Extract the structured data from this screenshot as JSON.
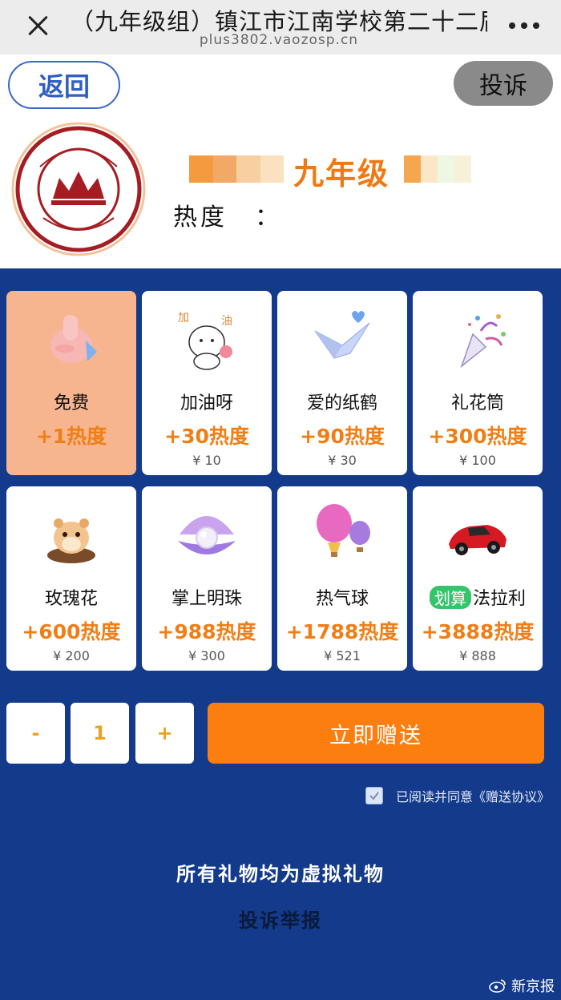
{
  "browser": {
    "title": "（九年级组）镇江市江南学校第二十二届",
    "url": "plus3802.vaozosp.cn",
    "close_icon": "close-icon",
    "more_icon": "more-dots-icon"
  },
  "header": {
    "back_label": "返回",
    "report_label": "投诉",
    "grade_label": "九年级",
    "heat_label": "热度　："
  },
  "gifts": [
    {
      "name": "免费",
      "heat": "+1热度",
      "price": "",
      "icon": "thumbs-up-icon",
      "selected": true
    },
    {
      "name": "加油呀",
      "heat": "+30热度",
      "price": "¥ 10",
      "icon": "cheer-bear-icon"
    },
    {
      "name": "爱的纸鹤",
      "heat": "+90热度",
      "price": "¥ 30",
      "icon": "paper-crane-icon"
    },
    {
      "name": "礼花筒",
      "heat": "+300热度",
      "price": "¥ 100",
      "icon": "party-popper-icon"
    },
    {
      "name": "玫瑰花",
      "heat": "+600热度",
      "price": "¥ 200",
      "icon": "hamster-icon"
    },
    {
      "name": "掌上明珠",
      "heat": "+988热度",
      "price": "¥ 300",
      "icon": "pearl-shell-icon"
    },
    {
      "name": "热气球",
      "heat": "+1788热度",
      "price": "¥ 521",
      "icon": "hot-air-balloon-icon"
    },
    {
      "name": "法拉利",
      "badge": "划算",
      "heat": "+3888热度",
      "price": "¥ 888",
      "icon": "red-car-icon"
    }
  ],
  "quantity": {
    "minus": "-",
    "value": "1",
    "plus": "+"
  },
  "send_label": "立即赠送",
  "agreement": {
    "text": "已阅读并同意《赠送协议》",
    "checked": true
  },
  "footer": {
    "note": "所有礼物均为虚拟礼物",
    "complaint": "投诉举报",
    "watermark": "新京报"
  },
  "colors": {
    "panel_blue": "#133a8b",
    "accent_orange": "#f07e16",
    "send_orange": "#fb7e0f",
    "selected_card": "#f7b58f"
  }
}
